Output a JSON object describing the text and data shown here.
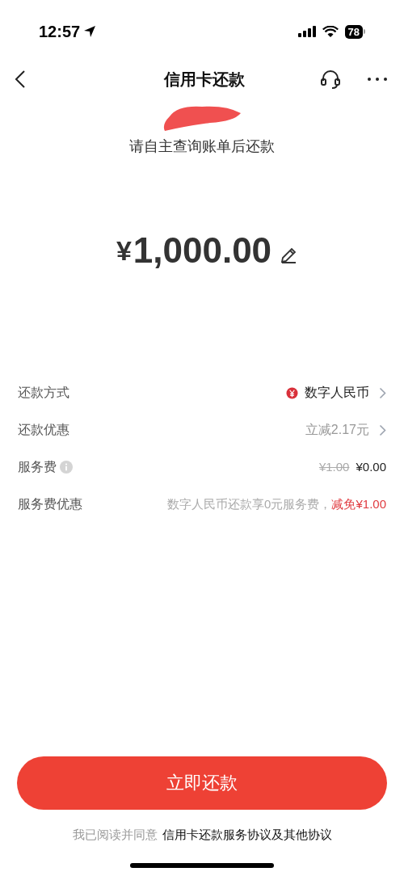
{
  "status_bar": {
    "time": "12:57",
    "battery": "78"
  },
  "nav": {
    "title": "信用卡还款"
  },
  "subtitle": "请自主查询账单后还款",
  "amount": {
    "currency": "¥",
    "value": "1,000.00"
  },
  "rows": [
    {
      "kind": "method",
      "label": "还款方式",
      "value": "数字人民币"
    },
    {
      "kind": "discount",
      "label": "还款优惠",
      "value": "立减2.17元"
    },
    {
      "kind": "fee",
      "label": "服务费",
      "original": "¥1.00",
      "value": "¥0.00"
    },
    {
      "kind": "promo",
      "label": "服务费优惠",
      "value": "数字人民币还款享0元服务费，",
      "highlight": "减免¥1.00"
    }
  ],
  "primary_button": "立即还款",
  "agreement": {
    "prefix": "我已阅读并同意",
    "link": "信用卡还款服务协议及其他协议"
  }
}
